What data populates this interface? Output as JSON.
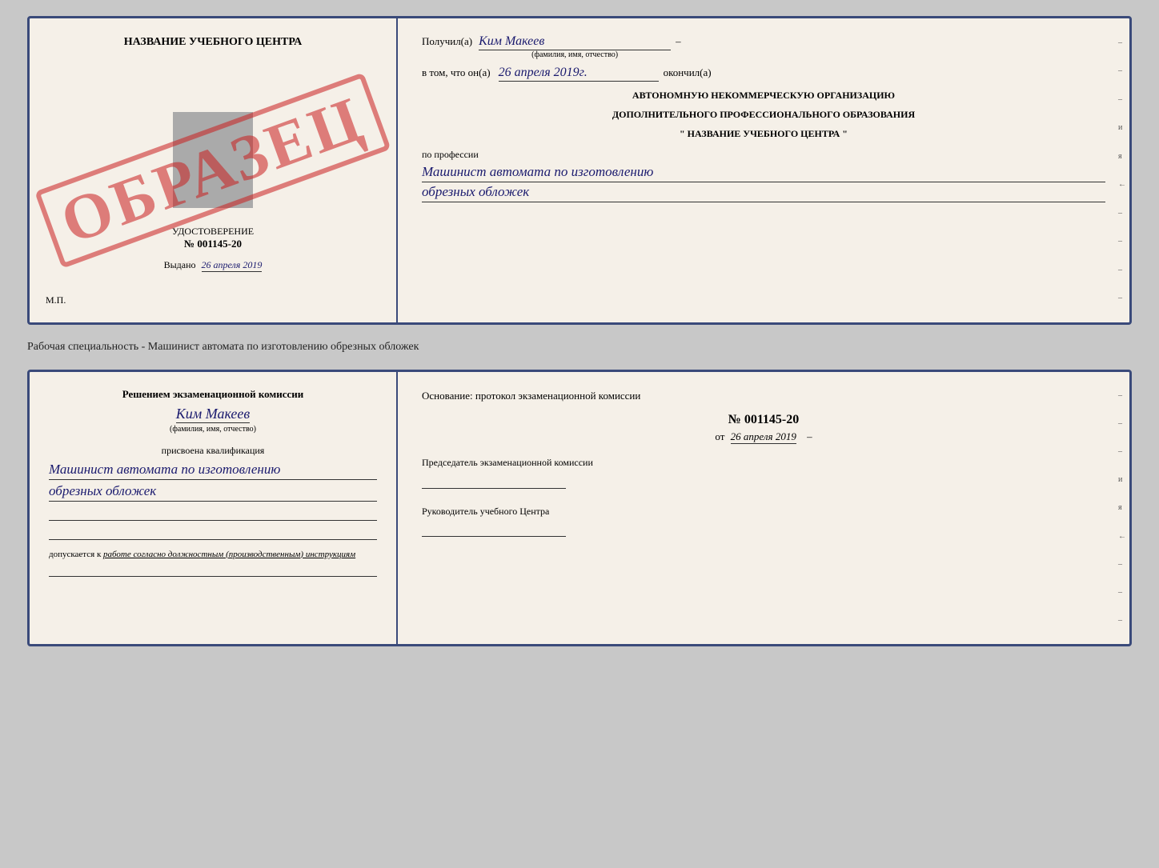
{
  "topCard": {
    "left": {
      "title": "НАЗВАНИЕ УЧЕБНОГО ЦЕНТРА",
      "watermark": "ОБРАЗЕЦ",
      "certLabel": "УДОСТОВЕРЕНИЕ",
      "certNumber": "№ 001145-20",
      "issuedLabel": "Выдано",
      "issuedDate": "26 апреля 2019",
      "mpLabel": "М.П."
    },
    "right": {
      "receivedLabel": "Получил(а)",
      "receivedName": "Ким Макеев",
      "nameSubLabel": "(фамилия, имя, отчество)",
      "inThatLabel": "в том, что он(а)",
      "inThatDate": "26 апреля 2019г.",
      "finishedLabel": "окончил(а)",
      "orgLine1": "АВТОНОМНУЮ НЕКОММЕРЧЕСКУЮ ОРГАНИЗАЦИЮ",
      "orgLine2": "ДОПОЛНИТЕЛЬНОГО ПРОФЕССИОНАЛЬНОГО ОБРАЗОВАНИЯ",
      "orgLine3": "\"   НАЗВАНИЕ УЧЕБНОГО ЦЕНТРА   \"",
      "professionLabel": "по профессии",
      "professionLine1": "Машинист автомата по изготовлению",
      "professionLine2": "обрезных обложек",
      "sideMarks": [
        "–",
        "–",
        "–",
        "и",
        "я",
        "←",
        "–",
        "–",
        "–",
        "–"
      ]
    }
  },
  "separator": {
    "text": "Рабочая специальность - Машинист автомата по изготовлению обрезных обложек"
  },
  "bottomCard": {
    "left": {
      "decisionLabel": "Решением экзаменационной комиссии",
      "personName": "Ким Макеев",
      "nameSubLabel": "(фамилия, имя, отчество)",
      "assignedLabel": "присвоена квалификация",
      "qualLine1": "Машинист автомата по изготовлению",
      "qualLine2": "обрезных обложек",
      "allowsText": "допускается к",
      "allowsUnderlineText": "работе согласно должностным (производственным) инструкциям"
    },
    "right": {
      "basisLabel": "Основание: протокол экзаменационной комиссии",
      "protocolNumber": "№ 001145-20",
      "protocolDatePrefix": "от",
      "protocolDate": "26 апреля 2019",
      "chairLabel": "Председатель экзаменационной комиссии",
      "directorLabel": "Руководитель учебного Центра",
      "sideMarks": [
        "–",
        "–",
        "–",
        "и",
        "я",
        "←",
        "–",
        "–",
        "–"
      ]
    }
  }
}
